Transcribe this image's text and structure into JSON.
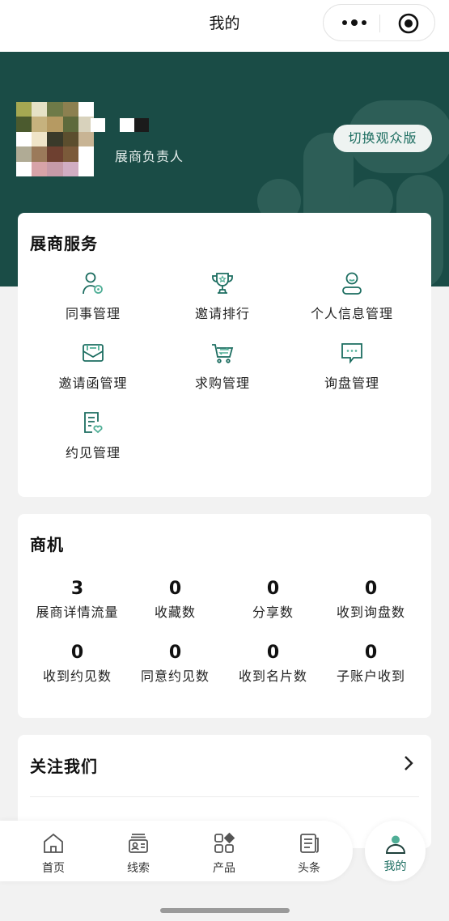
{
  "header": {
    "title": "我的"
  },
  "profile": {
    "role": "展商负责人",
    "switch_label": "切换观众版",
    "avatar_pixels": [
      "#a5a852",
      "#e6e2c6",
      "#6e7a48",
      "#8c8050",
      "#ffffff",
      "#4b5a2e",
      "#c6b27e",
      "#b69a62",
      "#5e6a3c",
      "#d8d2bc",
      "#ffffff",
      "#efe4c8",
      "#3a3a2a",
      "#5c4e2e",
      "#c8b494",
      "#b0ab95",
      "#9b7a5a",
      "#6e4030",
      "#7b5a3a",
      "#ffffff",
      "#ffffff",
      "#d7a3a8",
      "#c69aa8",
      "#d1adc2",
      "#ffffff"
    ]
  },
  "services": {
    "title": "展商服务",
    "items": [
      {
        "label": "同事管理",
        "icon": "colleague-icon"
      },
      {
        "label": "邀请排行",
        "icon": "trophy-icon"
      },
      {
        "label": "个人信息管理",
        "icon": "user-info-icon"
      },
      {
        "label": "邀请函管理",
        "icon": "envelope-icon"
      },
      {
        "label": "求购管理",
        "icon": "cart-icon"
      },
      {
        "label": "询盘管理",
        "icon": "chat-icon"
      },
      {
        "label": "约见管理",
        "icon": "appointment-icon"
      }
    ]
  },
  "opportunities": {
    "title": "商机",
    "stats": [
      {
        "value": "3",
        "label": "展商详情流量"
      },
      {
        "value": "0",
        "label": "收藏数"
      },
      {
        "value": "0",
        "label": "分享数"
      },
      {
        "value": "0",
        "label": "收到询盘数"
      },
      {
        "value": "0",
        "label": "收到约见数"
      },
      {
        "value": "0",
        "label": "同意约见数"
      },
      {
        "value": "0",
        "label": "收到名片数"
      },
      {
        "value": "0",
        "label": "子账户收到"
      }
    ]
  },
  "follow": {
    "label": "关注我们"
  },
  "tabbar": {
    "items": [
      {
        "label": "首页",
        "icon": "home-icon"
      },
      {
        "label": "线索",
        "icon": "leads-icon"
      },
      {
        "label": "产品",
        "icon": "product-icon"
      },
      {
        "label": "头条",
        "icon": "news-icon"
      },
      {
        "label": "我的",
        "icon": "profile-icon",
        "active": true
      }
    ]
  },
  "colors": {
    "primary": "#1a4c46",
    "accent": "#1c6d60",
    "accent_light": "#4fae96"
  }
}
